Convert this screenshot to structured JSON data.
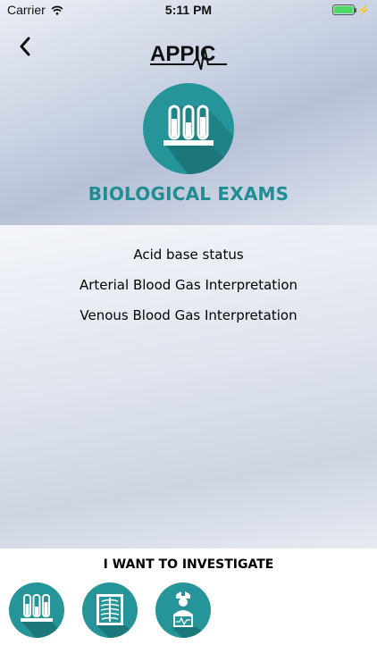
{
  "status_bar": {
    "carrier": "Carrier",
    "time": "5:11 PM",
    "wifi_icon": "wifi-icon",
    "battery_icon": "battery-icon",
    "battery_level": 1.0,
    "charging_icon": "charging-bolt-icon"
  },
  "header": {
    "back_icon": "chevron-left-icon",
    "logo_text": "APPIC",
    "category_icon": "test-tubes-icon",
    "title": "BIOLOGICAL EXAMS"
  },
  "exam_list": {
    "items": [
      {
        "label": "Acid base status"
      },
      {
        "label": "Arterial Blood Gas Interpretation"
      },
      {
        "label": "Venous Blood Gas Interpretation"
      }
    ]
  },
  "bottom_bar": {
    "title": "I WANT TO INVESTIGATE",
    "options": [
      {
        "icon": "test-tubes-icon"
      },
      {
        "icon": "chest-xray-icon"
      },
      {
        "icon": "doctor-monitor-icon"
      }
    ]
  },
  "colors": {
    "accent": "#25959a",
    "title_teal": "#1f8e94",
    "shadow": "#1c7377"
  }
}
